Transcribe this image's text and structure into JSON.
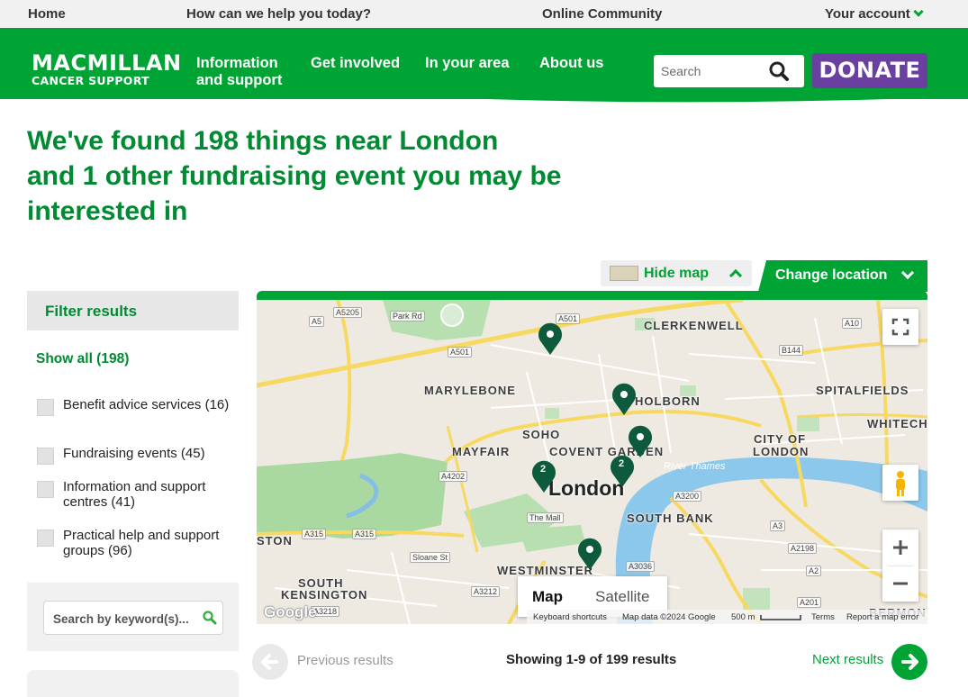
{
  "utility_nav": {
    "home": "Home",
    "help": "How can we help you today?",
    "community": "Online Community",
    "account": "Your account"
  },
  "header": {
    "logo_line1": "MACMILLAN",
    "logo_line2": "CANCER SUPPORT",
    "nav": [
      {
        "line1": "Information",
        "line2": "and support"
      },
      {
        "line1": "Get involved",
        "line2": ""
      },
      {
        "line1": "In your area",
        "line2": ""
      },
      {
        "line1": "About us",
        "line2": ""
      }
    ],
    "search_placeholder": "Search",
    "donate": "DONATE"
  },
  "heading": {
    "line1": "We've found 198 things near London",
    "line2": "and 1 other fundraising event you may be",
    "line3": "interested in"
  },
  "map_controls": {
    "hide_map": "Hide map",
    "change_location": "Change location",
    "map_type": "Map",
    "satellite_type": "Satellite"
  },
  "filter": {
    "title": "Filter results",
    "show_all": "Show all (198)",
    "options": [
      {
        "label": "Benefit advice services (16)",
        "checked": false
      },
      {
        "label": "Fundraising events (45)",
        "checked": false
      },
      {
        "label": "Information and support centres (41)",
        "checked": false
      },
      {
        "label": "Practical help and support groups (96)",
        "checked": false
      }
    ],
    "keyword_placeholder": "Search by keyword(s)..."
  },
  "map": {
    "city": "London",
    "river": "River Thames",
    "areas": [
      "CLERKENWELL",
      "MARYLEBONE",
      "HOLBORN",
      "SPITALFIELDS",
      "SOHO",
      "WHITECH",
      "MAYFAIR",
      "COVENT GARDEN",
      "CITY OF",
      "LONDON",
      "SOUTH BANK",
      "STON",
      "WESTMINSTER",
      "SOUTH",
      "KENSINGTON",
      "BERMON"
    ],
    "roads": [
      "A5205",
      "A501",
      "A5",
      "A4202",
      "A315",
      "A3200",
      "A3",
      "A2198",
      "A2",
      "A201",
      "A3036",
      "A3212",
      "A3218",
      "A10",
      "B144"
    ],
    "streets": [
      "Park Rd",
      "The Mall",
      "Sloane St"
    ],
    "cluster_counts": [
      "2",
      "2"
    ],
    "attribution": {
      "shortcuts": "Keyboard shortcuts",
      "data": "Map data ©2024 Google",
      "scale": "500 m",
      "terms": "Terms",
      "report": "Report a map error"
    },
    "google": "Google"
  },
  "pagination": {
    "previous": "Previous results",
    "showing": "Showing 1-9 of 199 results",
    "next": "Next results"
  },
  "colors": {
    "brand_green": "#00a435",
    "heading_green": "#008a32",
    "donate_purple": "#6b3fa0",
    "marker": "#0d5a3c"
  }
}
